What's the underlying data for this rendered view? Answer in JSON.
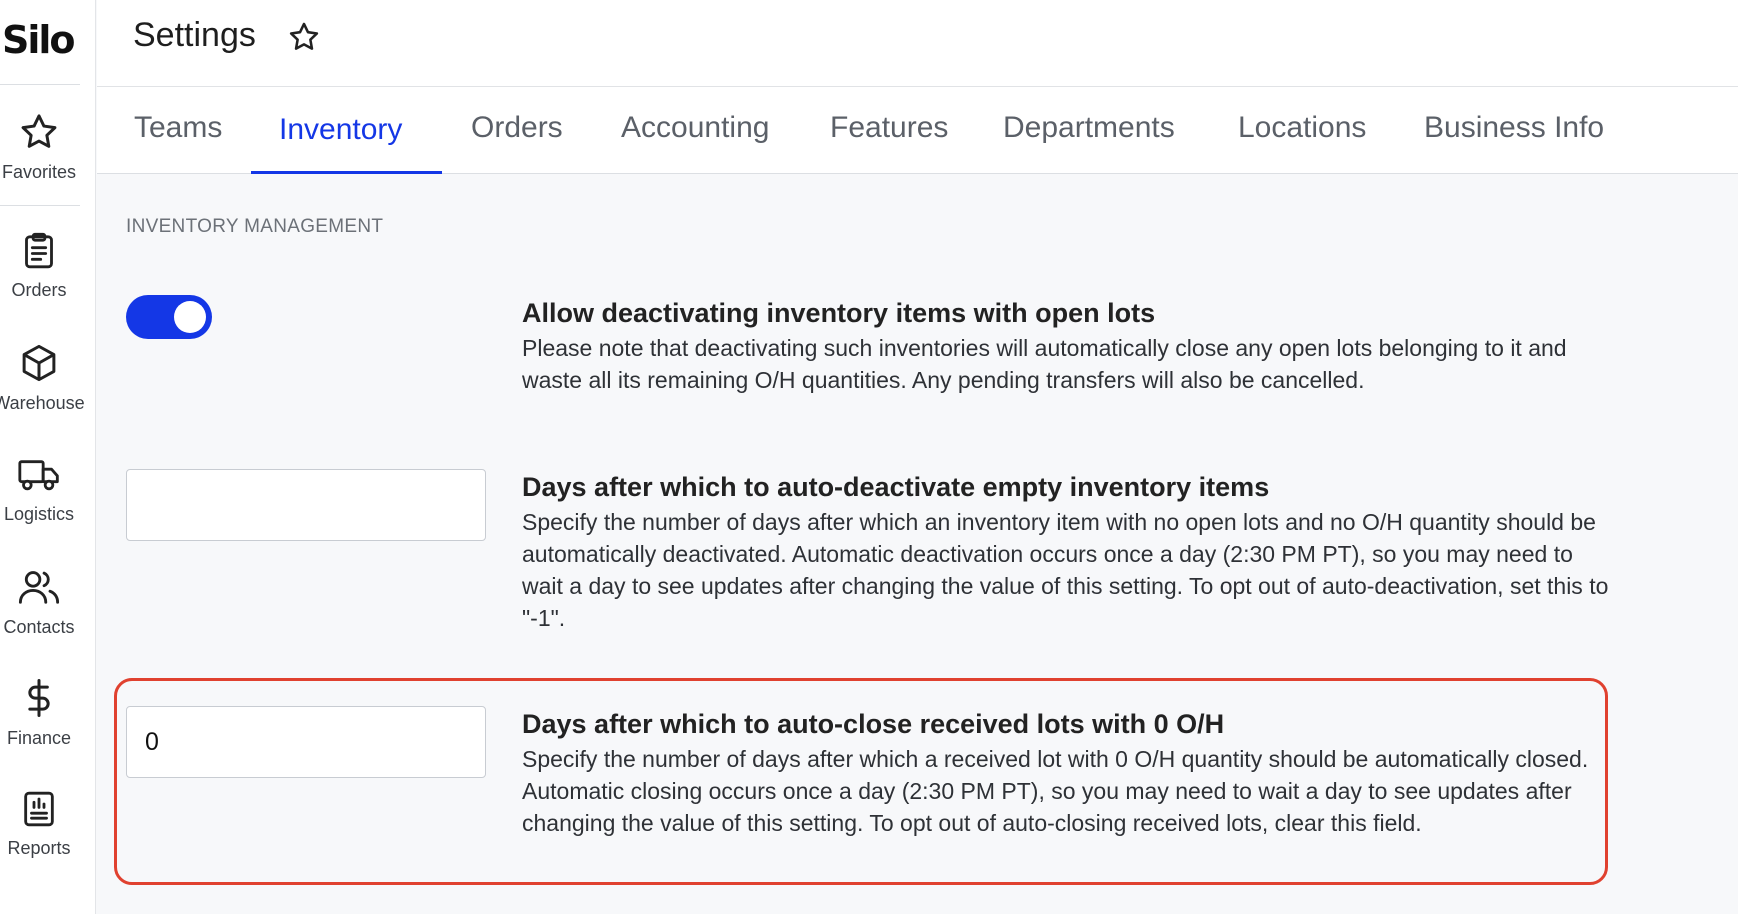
{
  "app": {
    "logo_text": "Silo"
  },
  "sidebar": {
    "items": [
      {
        "label": "Favorites",
        "icon": "star-icon"
      },
      {
        "label": "Orders",
        "icon": "clipboard-icon"
      },
      {
        "label": "Warehouse",
        "icon": "box-icon"
      },
      {
        "label": "Logistics",
        "icon": "truck-icon"
      },
      {
        "label": "Contacts",
        "icon": "users-icon"
      },
      {
        "label": "Finance",
        "icon": "dollar-icon"
      },
      {
        "label": "Reports",
        "icon": "report-icon"
      }
    ]
  },
  "header": {
    "title": "Settings"
  },
  "tabs": [
    {
      "label": "Teams",
      "active": false
    },
    {
      "label": "Inventory",
      "active": true
    },
    {
      "label": "Orders",
      "active": false
    },
    {
      "label": "Accounting",
      "active": false
    },
    {
      "label": "Features",
      "active": false
    },
    {
      "label": "Departments",
      "active": false
    },
    {
      "label": "Locations",
      "active": false
    },
    {
      "label": "Business Info",
      "active": false
    }
  ],
  "section": {
    "title": "INVENTORY MANAGEMENT",
    "settings": [
      {
        "control": "toggle",
        "enabled": true,
        "title": "Allow deactivating inventory items with open lots",
        "description": "Please note that deactivating such inventories will automatically close any open lots belonging to it and waste all its remaining O/H quantities. Any pending transfers will also be cancelled."
      },
      {
        "control": "input",
        "value": "",
        "title": "Days after which to auto-deactivate empty inventory items",
        "description": "Specify the number of days after which an inventory item with no open lots and no O/H quantity should be automatically deactivated. Automatic deactivation occurs once a day (2:30 PM PT), so you may need to wait a day to see updates after changing the value of this setting. To opt out of auto-deactivation, set this to \"-1\"."
      },
      {
        "control": "input",
        "value": "0",
        "title": "Days after which to auto-close received lots with 0 O/H",
        "description": "Specify the number of days after which a received lot with 0 O/H quantity should be automatically closed. Automatic closing occurs once a day (2:30 PM PT), so you may need to wait a day to see updates after changing the value of this setting. To opt out of auto-closing received lots, clear this field."
      }
    ]
  },
  "colors": {
    "accent": "#1437e6",
    "highlight": "#e0412f"
  }
}
